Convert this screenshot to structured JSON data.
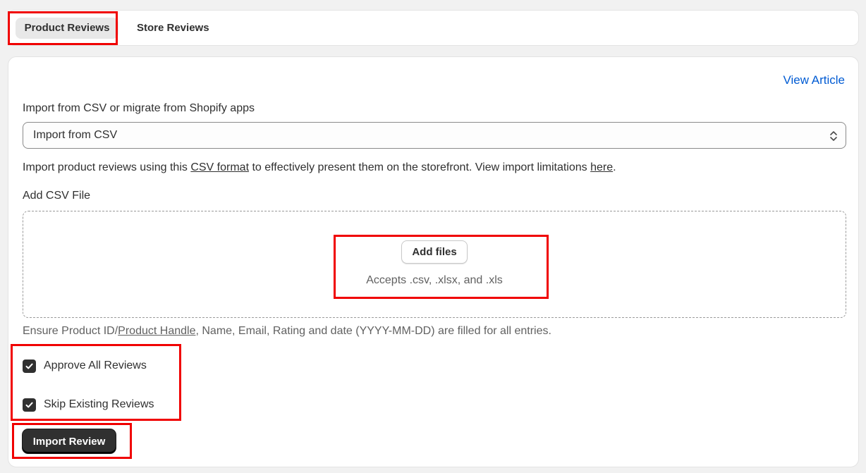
{
  "tabs": [
    {
      "label": "Product Reviews",
      "active": true
    },
    {
      "label": "Store Reviews",
      "active": false
    }
  ],
  "main": {
    "view_article": "View Article",
    "source_label": "Import from CSV or migrate from Shopify apps",
    "source_select": {
      "selected": "Import from CSV",
      "icon": "chevron-up-down-icon"
    },
    "description": {
      "prefix": "Import product reviews using this ",
      "csv_link": "CSV format",
      "middle": " to effectively present them on the storefront. View import limitations ",
      "here_link": "here",
      "suffix": "."
    },
    "file_label": "Add CSV File",
    "dropzone": {
      "button": "Add files",
      "accepts": "Accepts .csv, .xlsx, and .xls"
    },
    "note": {
      "prefix": "Ensure Product ID/",
      "link": "Product Handle",
      "suffix": ", Name, Email, Rating and date (YYYY-MM-DD) are filled for all entries."
    },
    "checkboxes": [
      {
        "label": "Approve All Reviews",
        "checked": true
      },
      {
        "label": "Skip Existing Reviews",
        "checked": true
      }
    ],
    "import_button": "Import Review"
  },
  "colors": {
    "highlight": "#f00000",
    "link": "#005bd3",
    "dark_button": "#303030"
  }
}
